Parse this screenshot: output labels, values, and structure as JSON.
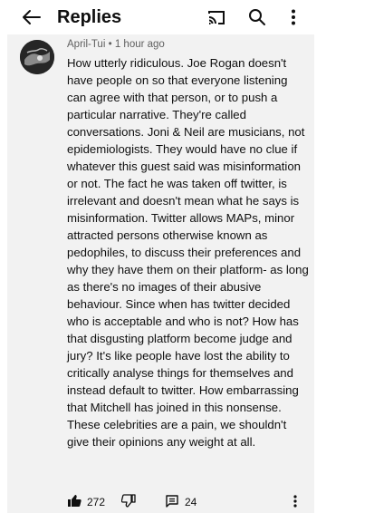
{
  "header": {
    "title": "Replies",
    "icons": [
      "back-arrow-icon",
      "cast-icon",
      "search-icon",
      "more-vert-icon"
    ]
  },
  "comment": {
    "author": "April-Tui",
    "separator": "•",
    "time": "1 hour ago",
    "text": "How utterly ridiculous. Joe Rogan doesn't have people on so that everyone listening can agree with that person, or to push a particular narrative. They're called conversations. Joni & Neil are musicians, not epidemiologists. They would have no clue if whatever this guest said was misinformation or not. The fact he was taken off twitter, is irrelevant and doesn't mean what he says is misinformation. Twitter allows MAPs, minor attracted persons otherwise known as pedophiles, to discuss their preferences and why they have them on their platform- as long as there's no images of their abusive behaviour. Since when has twitter decided who is acceptable and who is not? How has that disgusting platform become judge and jury? It's like people have lost the ability to critically analyse things for themselves and instead default to twitter. How embarrassing that Mitchell has joined in this nonsense. These celebrities are a pain, we shouldn't give their opinions any weight at all.",
    "likes": "272",
    "replies": "24"
  }
}
